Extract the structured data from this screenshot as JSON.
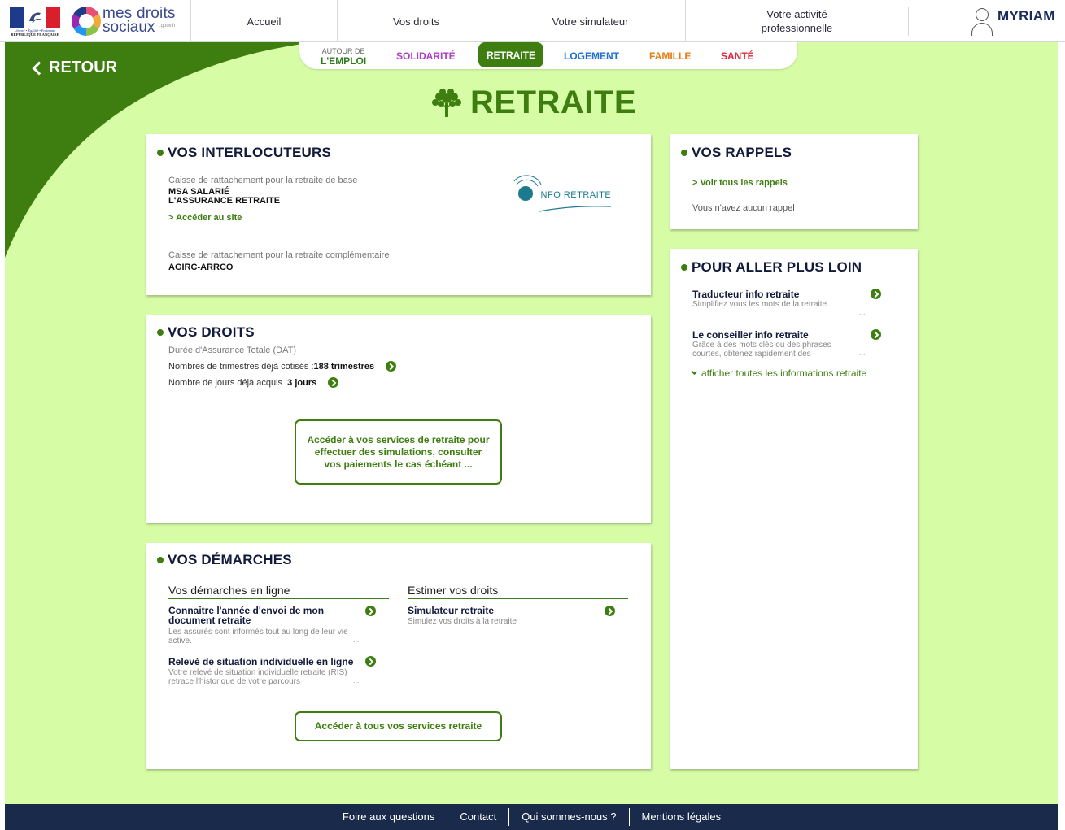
{
  "header": {
    "gov_logo": {
      "motto": "Liberté • Égalité • Fraternité",
      "name": "RÉPUBLIQUE FRANÇAISE"
    },
    "brand": {
      "line1": "mes droits",
      "line2": "sociaux",
      "suffix": ".gouv.fr"
    },
    "nav": [
      {
        "label": "Accueil"
      },
      {
        "label": "Vos droits"
      },
      {
        "label": "Votre simulateur"
      },
      {
        "label": "Votre activité professionnelle"
      }
    ],
    "user": {
      "name": "MYRIAM",
      "icon": "user-icon"
    }
  },
  "back": {
    "label": "RETOUR"
  },
  "subnav": {
    "emploi_small": "AUTOUR DE",
    "emploi_big": "L'EMPLOI",
    "items": [
      {
        "label": "SOLIDARITÉ",
        "color": "#b03ec4"
      },
      {
        "label": "RETRAITE",
        "color": "#ffffff"
      },
      {
        "label": "LOGEMENT",
        "color": "#1f6fd1"
      },
      {
        "label": "FAMILLE",
        "color": "#e57e12"
      },
      {
        "label": "SANTÉ",
        "color": "#e0243a"
      }
    ]
  },
  "page_title": "RETRAITE",
  "interlocuteurs": {
    "title": "VOS INTERLOCUTEURS",
    "base_label": "Caisse de rattachement pour la retraite de base",
    "base_org1": "MSA SALARIÉ",
    "base_org2": "L'ASSURANCE RETRAITE",
    "site_link": "> Accéder au site",
    "logo_text": "INFO RETRAITE",
    "comp_label": "Caisse de rattachement pour la retraite complémentaire",
    "comp_org": "AGIRC-ARRCO"
  },
  "droits": {
    "title": "VOS DROITS",
    "dat_label": "Durée d'Assurance Totale (DAT)",
    "trim_label": "Nombres de trimestres déjà cotisés : ",
    "trim_value": "188 trimestres",
    "jours_label": "Nombre de jours déjà acquis : ",
    "jours_value": "3 jours",
    "button": "Accéder à vos services de retraite pour effectuer des simulations, consulter vos paiements le cas échéant ..."
  },
  "demarches": {
    "title": "VOS DÉMARCHES",
    "col1_head": "Vos démarches en ligne",
    "col2_head": "Estimer vos droits",
    "item1_title": "Connaitre l'année d'envoi de mon document retraite",
    "item1_desc": "Les assurés sont informés tout au long de leur vie active.",
    "item2_title": "Relevé de situation individuelle en ligne",
    "item2_desc": "Votre relevé de situation individuelle retraite (RIS) retrace l'historique de votre parcours",
    "item3_title": "Simulateur retraite",
    "item3_desc": "Simulez vos droits à la retraite",
    "ellipsis": "...",
    "button": "Accéder à tous vos services retraite"
  },
  "rappels": {
    "title": "VOS RAPPELS",
    "link": "> Voir tous les rappels",
    "empty": "Vous n'avez aucun rappel"
  },
  "plus_loin": {
    "title": "POUR ALLER PLUS LOIN",
    "item1_title": "Traducteur info retraite",
    "item1_desc": "Simplifiez vous les mots de la retraite.",
    "item2_title": "Le conseiller info retraite",
    "item2_desc": "Grâce à des mots clés ou des phrases courtes, obtenez rapidement des",
    "ellipsis": "...",
    "show_all": "afficher toutes les informations retraite"
  },
  "footer": {
    "links": [
      {
        "label": "Foire aux questions"
      },
      {
        "label": "Contact"
      },
      {
        "label": "Qui sommes-nous ?"
      },
      {
        "label": "Mentions légales"
      }
    ]
  },
  "colors": {
    "accent": "#3e7e10",
    "background": "#d6fca6",
    "footer": "#1a2a4a"
  }
}
